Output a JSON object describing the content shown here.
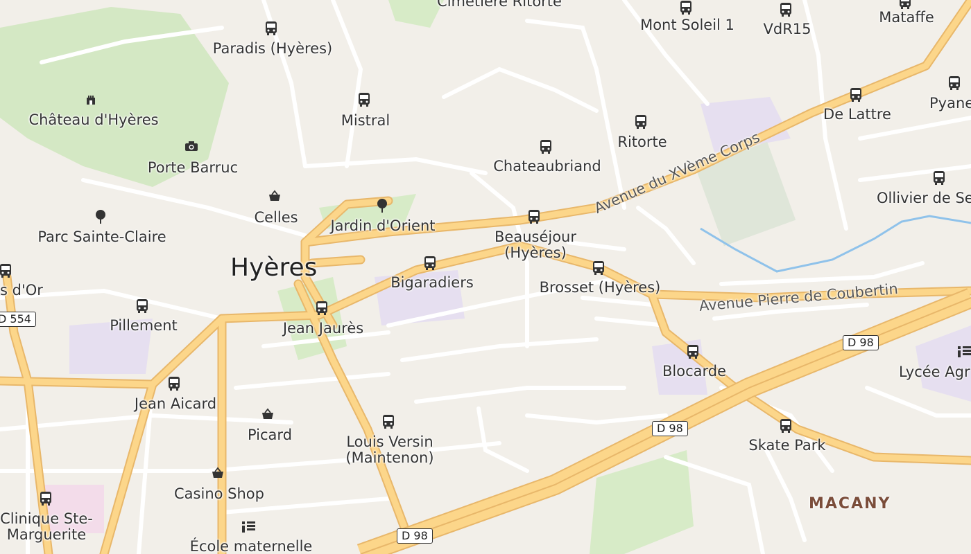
{
  "city": "Hyères",
  "district": "MACANY",
  "colors": {
    "background": "#f2efe9",
    "park": "#cfe6bd",
    "major_road": "#fcd68a",
    "major_road_casing": "#e8b76a",
    "minor_road": "#ffffff",
    "water": "#8fc2ea",
    "bus_icon": "#333333",
    "institution": "#e6dff0"
  },
  "bus_stops": [
    {
      "name": "Paradis (Hyères)"
    },
    {
      "name": "Mistral"
    },
    {
      "name": "Chateaubriand"
    },
    {
      "name": "Ritorte"
    },
    {
      "name": "Mont Soleil 1"
    },
    {
      "name": "VdR15"
    },
    {
      "name": "Mataffe"
    },
    {
      "name": "De Lattre"
    },
    {
      "name": "Pyane"
    },
    {
      "name": "Ollivier de Se"
    },
    {
      "name": "Beauséjour (Hyères)"
    },
    {
      "name": "Bigaradiers"
    },
    {
      "name": "Brosset (Hyères)"
    },
    {
      "name": "Jean Jaurès"
    },
    {
      "name": "Pillement"
    },
    {
      "name": "Jean Aicard"
    },
    {
      "name": "Louis Versin (Maintenon)"
    },
    {
      "name": "Blocarde"
    },
    {
      "name": "Skate Park"
    },
    {
      "name": "Clinique Ste-Marguerite"
    },
    {
      "name": "s d'Or"
    }
  ],
  "places": {
    "cimetiere": "Cimetière Ritorte",
    "chateau": "Château d'Hyères",
    "porte": "Porte Barruc",
    "parc": "Parc Sainte-Claire",
    "jardin": "Jardin d'Orient",
    "celles": "Celles",
    "picard": "Picard",
    "casino": "Casino Shop",
    "ecole": "École maternelle",
    "lycee": "Lycée Agr"
  },
  "streets": {
    "xveme": "Avenue du XVème Corps",
    "coubertin": "Avenue Pierre de Coubertin"
  },
  "route_shields": [
    "D 554",
    "D 98",
    "D 98",
    "D 98"
  ]
}
